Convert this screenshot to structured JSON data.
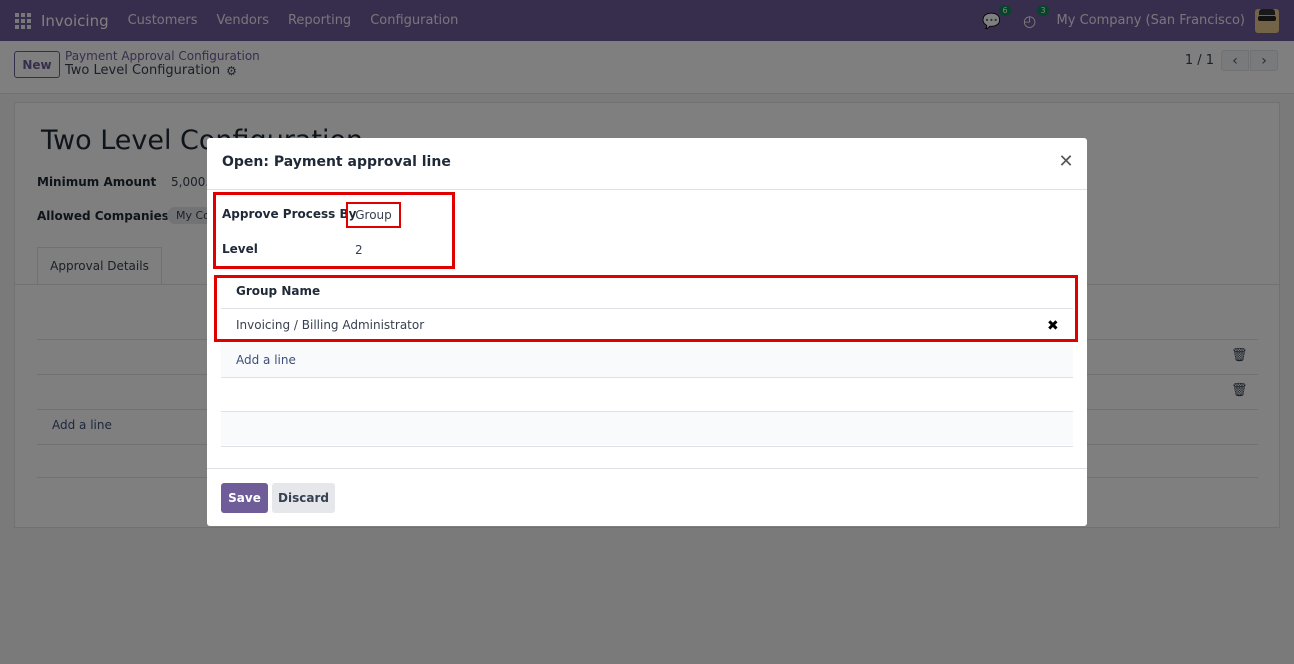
{
  "navbar": {
    "app_name": "Invoicing",
    "menu": [
      "Customers",
      "Vendors",
      "Reporting",
      "Configuration"
    ],
    "messages_count": "6",
    "activities_count": "3",
    "company": "My Company (San Francisco)"
  },
  "control_panel": {
    "new_label": "New",
    "breadcrumb_parent": "Payment Approval Configuration",
    "breadcrumb_current": "Two Level Configuration",
    "pager": "1 / 1"
  },
  "form": {
    "title": "Two Level Configuration",
    "minimum_amount_label": "Minimum Amount",
    "minimum_amount_value": "5,000.0",
    "allowed_companies_label": "Allowed Companies",
    "allowed_companies_tag": "My Co",
    "tab_label": "Approval Details",
    "add_line_label": "Add a line"
  },
  "modal": {
    "title": "Open: Payment approval line",
    "approve_process_label": "Approve Process By",
    "approve_process_value": "Group",
    "level_label": "Level",
    "level_value": "2",
    "table_header": "Group Name",
    "rows": [
      "Invoicing / Billing Administrator"
    ],
    "add_line_label": "Add a line",
    "save_label": "Save",
    "discard_label": "Discard"
  },
  "colors": {
    "brand": "#6f5d9a",
    "highlight": "#e00000"
  }
}
